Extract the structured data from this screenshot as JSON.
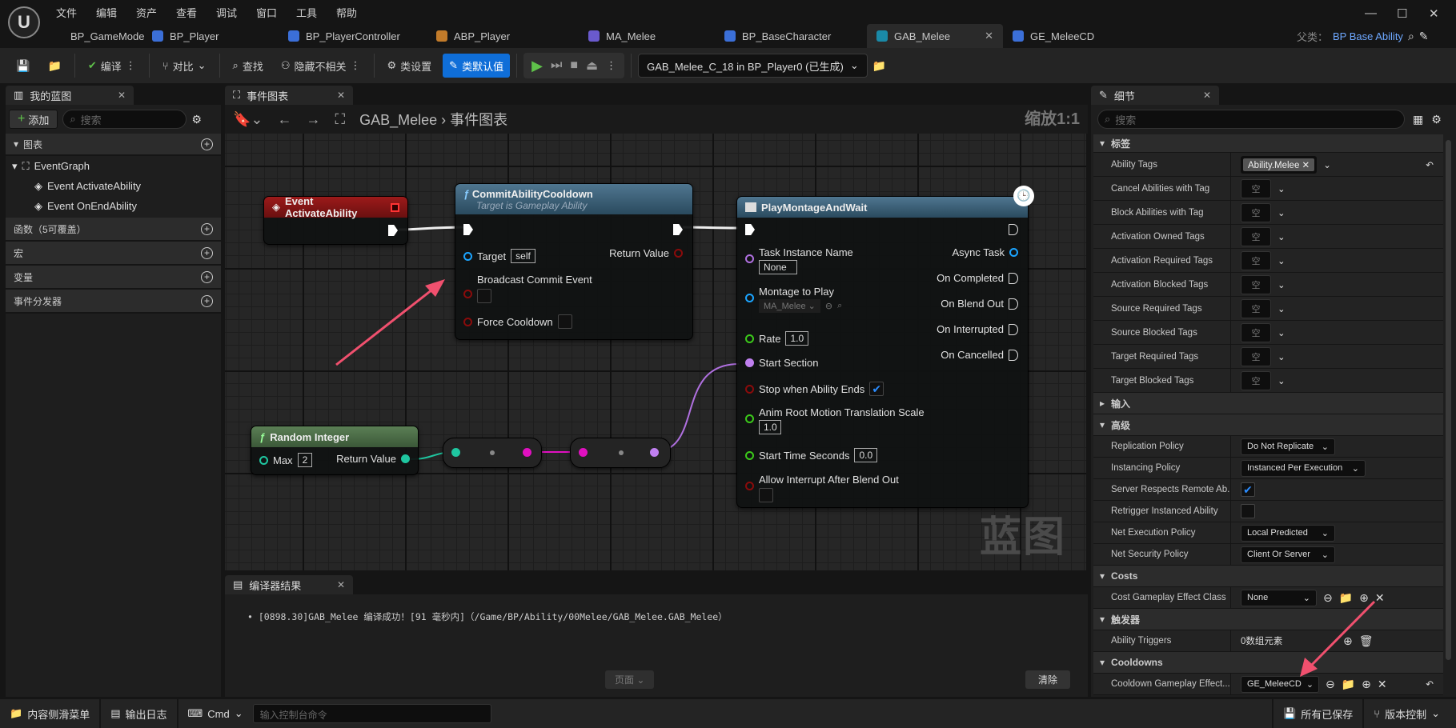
{
  "menu": [
    "文件",
    "编辑",
    "资产",
    "查看",
    "调试",
    "窗口",
    "工具",
    "帮助"
  ],
  "tabs": [
    {
      "label": "BP_GameMode",
      "color": "#3b6fd8"
    },
    {
      "label": "BP_Player",
      "color": "#3b6fd8"
    },
    {
      "label": "BP_PlayerController",
      "color": "#3b6fd8"
    },
    {
      "label": "ABP_Player",
      "color": "#c27b2a"
    },
    {
      "label": "MA_Melee",
      "color": "#6a5acd"
    },
    {
      "label": "BP_BaseCharacter",
      "color": "#3b6fd8"
    },
    {
      "label": "GAB_Melee",
      "color": "#1a8aa8",
      "active": true
    },
    {
      "label": "GE_MeleeCD",
      "color": "#3b6fd8"
    }
  ],
  "parent": {
    "label": "父类：",
    "value": "BP Base Ability"
  },
  "toolbar": {
    "compile": "编译",
    "diff": "对比",
    "find": "查找",
    "hide_unrelated": "隐藏不相关",
    "class_settings": "类设置",
    "class_defaults": "类默认值",
    "debug_object": "GAB_Melee_C_18 in BP_Player0 (已生成)"
  },
  "my_blueprint": {
    "title": "我的蓝图",
    "add": "添加",
    "search_placeholder": "搜索",
    "graphs": "图表",
    "event_graph": "EventGraph",
    "events": [
      "Event ActivateAbility",
      "Event OnEndAbility"
    ],
    "categories": [
      "函数（5可覆盖）",
      "宏",
      "变量",
      "事件分发器"
    ]
  },
  "graph": {
    "tab": "事件图表",
    "breadcrumb_root": "GAB_Melee",
    "breadcrumb_leaf": "事件图表",
    "zoom": "缩放1:1",
    "watermark": "蓝图",
    "event_node": {
      "title": "Event ActivateAbility"
    },
    "commit_node": {
      "title": "CommitAbilityCooldown",
      "subtitle": "Target is Gameplay Ability",
      "target": "Target",
      "target_value": "self",
      "return_value": "Return Value",
      "broadcast": "Broadcast Commit Event",
      "force": "Force Cooldown"
    },
    "montage_node": {
      "title": "PlayMontageAndWait",
      "task_name": "Task Instance Name",
      "task_value": "None",
      "montage": "Montage to Play",
      "montage_value": "MA_Melee",
      "rate": "Rate",
      "rate_value": "1.0",
      "start_section": "Start Section",
      "stop_when": "Stop when Ability Ends",
      "stop_checked": true,
      "anim_scale": "Anim Root Motion Translation Scale",
      "anim_scale_value": "1.0",
      "start_time": "Start Time Seconds",
      "start_time_value": "0.0",
      "allow_interrupt": "Allow Interrupt After Blend Out",
      "async_task": "Async Task",
      "on_completed": "On Completed",
      "on_blend_out": "On Blend Out",
      "on_interrupted": "On Interrupted",
      "on_cancelled": "On Cancelled"
    },
    "random_node": {
      "title": "Random Integer",
      "max": "Max",
      "max_value": "2",
      "return_value": "Return Value"
    }
  },
  "compiler": {
    "tab": "编译器结果",
    "message": "[0898.30]GAB_Melee 编译成功！[91 毫秒内]（/Game/BP/Ability/00Melee/GAB_Melee.GAB_Melee）",
    "page": "页面",
    "clear": "清除"
  },
  "details": {
    "title": "细节",
    "search_placeholder": "搜索",
    "tags_section": "标签",
    "ability_tags_label": "Ability Tags",
    "ability_tag_value": "Ability.Melee",
    "tag_rows": [
      "Cancel Abilities with Tag",
      "Block Abilities with Tag",
      "Activation Owned Tags",
      "Activation Required Tags",
      "Activation Blocked Tags",
      "Source Required Tags",
      "Source Blocked Tags",
      "Target Required Tags",
      "Target Blocked Tags"
    ],
    "empty": "空",
    "input_section": "输入",
    "advanced_section": "高级",
    "advanced_rows": [
      {
        "label": "Replication Policy",
        "value": "Do Not Replicate",
        "type": "combo"
      },
      {
        "label": "Instancing Policy",
        "value": "Instanced Per Execution",
        "type": "combo"
      },
      {
        "label": "Server Respects Remote Ab...",
        "checked": true,
        "type": "check"
      },
      {
        "label": "Retrigger Instanced Ability",
        "checked": false,
        "type": "check"
      },
      {
        "label": "Net Execution Policy",
        "value": "Local Predicted",
        "type": "combo"
      },
      {
        "label": "Net Security Policy",
        "value": "Client Or Server",
        "type": "combo"
      }
    ],
    "costs_section": "Costs",
    "cost_label": "Cost Gameplay Effect Class",
    "cost_value": "None",
    "triggers_section": "触发器",
    "triggers_label": "Ability Triggers",
    "triggers_value": "0数组元素",
    "cooldowns_section": "Cooldowns",
    "cooldown_label": "Cooldown Gameplay Effect...",
    "cooldown_value": "GE_MeleeCD"
  },
  "statusbar": {
    "content_drawer": "内容侧滑菜单",
    "output_log": "输出日志",
    "cmd": "Cmd",
    "console_placeholder": "输入控制台命令",
    "all_saved": "所有已保存",
    "source_control": "版本控制"
  },
  "colors": {
    "accent": "#0f6ed8",
    "event_header": "#8b1414",
    "function_header": "#3d6680",
    "pure_header": "#4d7048",
    "annotation_arrow": "#f0506e"
  }
}
